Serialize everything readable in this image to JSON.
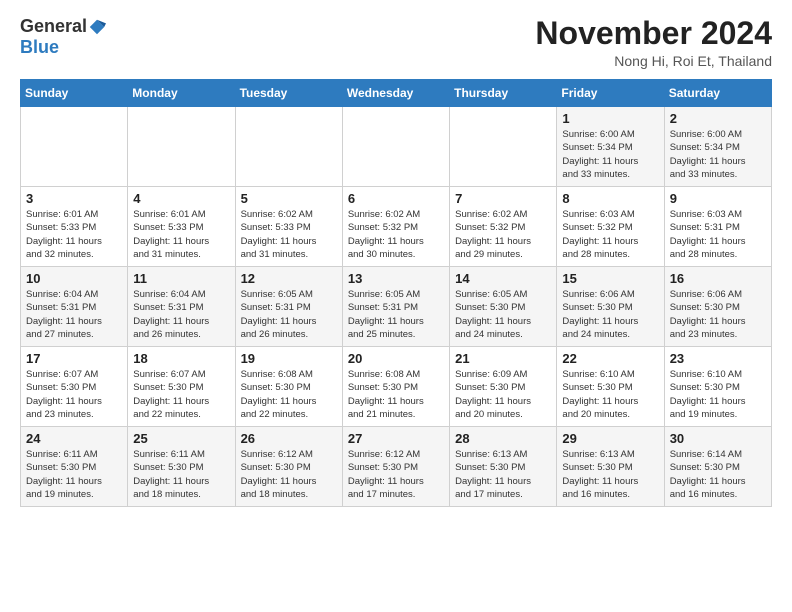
{
  "header": {
    "logo_general": "General",
    "logo_blue": "Blue",
    "month_title": "November 2024",
    "location": "Nong Hi, Roi Et, Thailand"
  },
  "days_of_week": [
    "Sunday",
    "Monday",
    "Tuesday",
    "Wednesday",
    "Thursday",
    "Friday",
    "Saturday"
  ],
  "weeks": [
    [
      {
        "day": "",
        "info": ""
      },
      {
        "day": "",
        "info": ""
      },
      {
        "day": "",
        "info": ""
      },
      {
        "day": "",
        "info": ""
      },
      {
        "day": "",
        "info": ""
      },
      {
        "day": "1",
        "info": "Sunrise: 6:00 AM\nSunset: 5:34 PM\nDaylight: 11 hours\nand 33 minutes."
      },
      {
        "day": "2",
        "info": "Sunrise: 6:00 AM\nSunset: 5:34 PM\nDaylight: 11 hours\nand 33 minutes."
      }
    ],
    [
      {
        "day": "3",
        "info": "Sunrise: 6:01 AM\nSunset: 5:33 PM\nDaylight: 11 hours\nand 32 minutes."
      },
      {
        "day": "4",
        "info": "Sunrise: 6:01 AM\nSunset: 5:33 PM\nDaylight: 11 hours\nand 31 minutes."
      },
      {
        "day": "5",
        "info": "Sunrise: 6:02 AM\nSunset: 5:33 PM\nDaylight: 11 hours\nand 31 minutes."
      },
      {
        "day": "6",
        "info": "Sunrise: 6:02 AM\nSunset: 5:32 PM\nDaylight: 11 hours\nand 30 minutes."
      },
      {
        "day": "7",
        "info": "Sunrise: 6:02 AM\nSunset: 5:32 PM\nDaylight: 11 hours\nand 29 minutes."
      },
      {
        "day": "8",
        "info": "Sunrise: 6:03 AM\nSunset: 5:32 PM\nDaylight: 11 hours\nand 28 minutes."
      },
      {
        "day": "9",
        "info": "Sunrise: 6:03 AM\nSunset: 5:31 PM\nDaylight: 11 hours\nand 28 minutes."
      }
    ],
    [
      {
        "day": "10",
        "info": "Sunrise: 6:04 AM\nSunset: 5:31 PM\nDaylight: 11 hours\nand 27 minutes."
      },
      {
        "day": "11",
        "info": "Sunrise: 6:04 AM\nSunset: 5:31 PM\nDaylight: 11 hours\nand 26 minutes."
      },
      {
        "day": "12",
        "info": "Sunrise: 6:05 AM\nSunset: 5:31 PM\nDaylight: 11 hours\nand 26 minutes."
      },
      {
        "day": "13",
        "info": "Sunrise: 6:05 AM\nSunset: 5:31 PM\nDaylight: 11 hours\nand 25 minutes."
      },
      {
        "day": "14",
        "info": "Sunrise: 6:05 AM\nSunset: 5:30 PM\nDaylight: 11 hours\nand 24 minutes."
      },
      {
        "day": "15",
        "info": "Sunrise: 6:06 AM\nSunset: 5:30 PM\nDaylight: 11 hours\nand 24 minutes."
      },
      {
        "day": "16",
        "info": "Sunrise: 6:06 AM\nSunset: 5:30 PM\nDaylight: 11 hours\nand 23 minutes."
      }
    ],
    [
      {
        "day": "17",
        "info": "Sunrise: 6:07 AM\nSunset: 5:30 PM\nDaylight: 11 hours\nand 23 minutes."
      },
      {
        "day": "18",
        "info": "Sunrise: 6:07 AM\nSunset: 5:30 PM\nDaylight: 11 hours\nand 22 minutes."
      },
      {
        "day": "19",
        "info": "Sunrise: 6:08 AM\nSunset: 5:30 PM\nDaylight: 11 hours\nand 22 minutes."
      },
      {
        "day": "20",
        "info": "Sunrise: 6:08 AM\nSunset: 5:30 PM\nDaylight: 11 hours\nand 21 minutes."
      },
      {
        "day": "21",
        "info": "Sunrise: 6:09 AM\nSunset: 5:30 PM\nDaylight: 11 hours\nand 20 minutes."
      },
      {
        "day": "22",
        "info": "Sunrise: 6:10 AM\nSunset: 5:30 PM\nDaylight: 11 hours\nand 20 minutes."
      },
      {
        "day": "23",
        "info": "Sunrise: 6:10 AM\nSunset: 5:30 PM\nDaylight: 11 hours\nand 19 minutes."
      }
    ],
    [
      {
        "day": "24",
        "info": "Sunrise: 6:11 AM\nSunset: 5:30 PM\nDaylight: 11 hours\nand 19 minutes."
      },
      {
        "day": "25",
        "info": "Sunrise: 6:11 AM\nSunset: 5:30 PM\nDaylight: 11 hours\nand 18 minutes."
      },
      {
        "day": "26",
        "info": "Sunrise: 6:12 AM\nSunset: 5:30 PM\nDaylight: 11 hours\nand 18 minutes."
      },
      {
        "day": "27",
        "info": "Sunrise: 6:12 AM\nSunset: 5:30 PM\nDaylight: 11 hours\nand 17 minutes."
      },
      {
        "day": "28",
        "info": "Sunrise: 6:13 AM\nSunset: 5:30 PM\nDaylight: 11 hours\nand 17 minutes."
      },
      {
        "day": "29",
        "info": "Sunrise: 6:13 AM\nSunset: 5:30 PM\nDaylight: 11 hours\nand 16 minutes."
      },
      {
        "day": "30",
        "info": "Sunrise: 6:14 AM\nSunset: 5:30 PM\nDaylight: 11 hours\nand 16 minutes."
      }
    ]
  ]
}
